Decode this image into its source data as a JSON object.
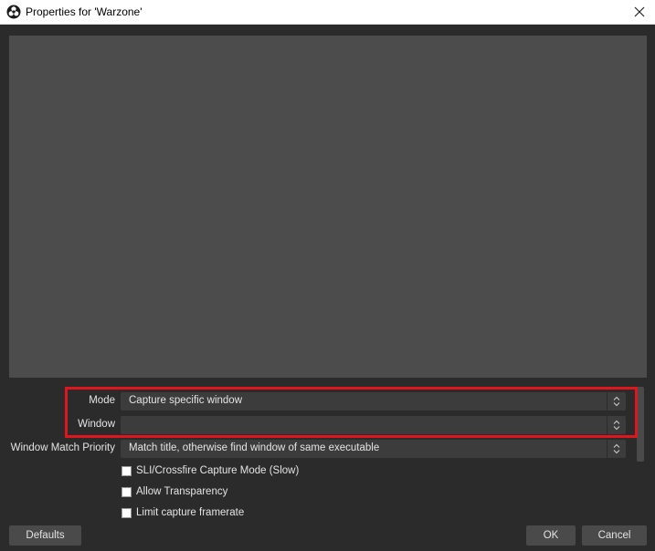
{
  "window": {
    "title": "Properties for 'Warzone'"
  },
  "icons": {
    "app": "obs-logo-icon",
    "close": "close-icon",
    "combo_arrows": "up-down-chevron-icon"
  },
  "form": {
    "mode": {
      "label": "Mode",
      "value": "Capture specific window"
    },
    "window": {
      "label": "Window",
      "value": ""
    },
    "match_priority": {
      "label": "Window Match Priority",
      "value": "Match title, otherwise find window of same executable"
    },
    "checkboxes": [
      {
        "label": "SLI/Crossfire Capture Mode (Slow)",
        "checked": false
      },
      {
        "label": "Allow Transparency",
        "checked": false
      },
      {
        "label": "Limit capture framerate",
        "checked": false
      }
    ]
  },
  "buttons": {
    "defaults": "Defaults",
    "ok": "OK",
    "cancel": "Cancel"
  },
  "colors": {
    "background": "#2b2b2b",
    "preview": "#4c4c4c",
    "highlight": "#e0161f",
    "field": "#3c3c3c",
    "button": "#4a4a4a"
  }
}
